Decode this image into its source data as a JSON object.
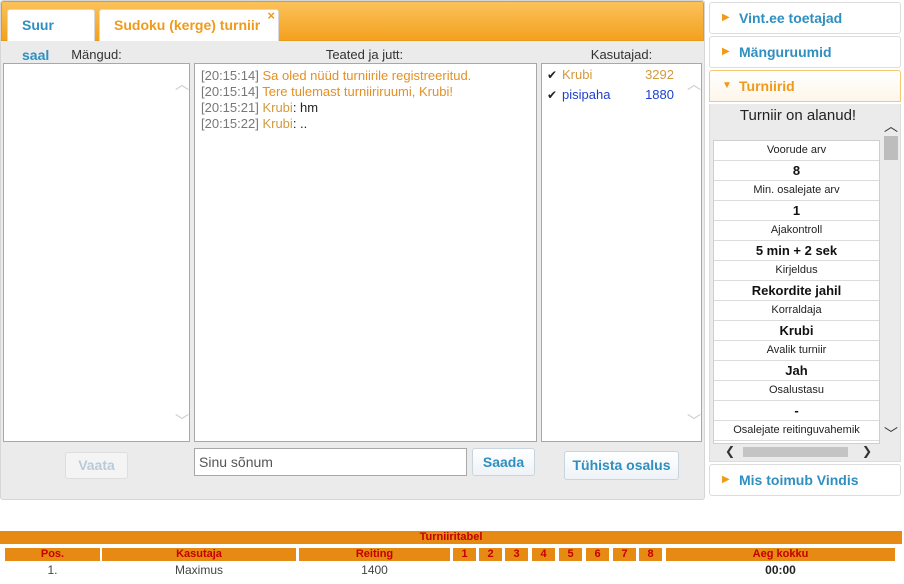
{
  "tabs": [
    {
      "label": "Suur saal"
    },
    {
      "label": "Sudoku (kerge) turniir",
      "close": "×"
    }
  ],
  "columns": {
    "games": "Mängud:",
    "chat": "Teated ja jutt:",
    "users": "Kasutajad:"
  },
  "chat": [
    {
      "time": "[20:15:14]",
      "text": "Sa oled nüüd turniirile registreeritud."
    },
    {
      "time": "[20:15:14]",
      "text": "Tere tulemast turniiriruumi, Krubi!"
    },
    {
      "time": "[20:15:21]",
      "nick": "Krubi",
      "text": ": hm"
    },
    {
      "time": "[20:15:22]",
      "nick": "Krubi",
      "text": ": .."
    }
  ],
  "users": [
    {
      "name": "Krubi",
      "rating": "3292",
      "color": "#d49a3d"
    },
    {
      "name": "pisipaha",
      "rating": "1880",
      "color": "#1c3fd0"
    }
  ],
  "buttons": {
    "view": "Vaata",
    "send": "Saada",
    "cancel": "Tühista osalus"
  },
  "message_input": {
    "placeholder": "Sinu sõnum",
    "value": ""
  },
  "sidebar": {
    "items": [
      {
        "label": "Vint.ee toetajad"
      },
      {
        "label": "Mänguruumid"
      },
      {
        "label": "Turniirid"
      },
      {
        "label": "Mis toimub Vindis"
      }
    ],
    "tournament_status": "Turniir on alanud!",
    "tournament_info": [
      {
        "label": "Voorude arv",
        "value": "8"
      },
      {
        "label": "Min. osalejate arv",
        "value": "1"
      },
      {
        "label": "Ajakontroll",
        "value": "5 min + 2 sek"
      },
      {
        "label": "Kirjeldus",
        "value": "Rekordite jahil"
      },
      {
        "label": "Korraldaja",
        "value": "Krubi"
      },
      {
        "label": "Avalik turniir",
        "value": "Jah"
      },
      {
        "label": "Osalustasu",
        "value": "-"
      },
      {
        "label": "Osalejate reitinguvahemik",
        "value": ""
      }
    ]
  },
  "standings": {
    "title": "Turniiritabel",
    "headers": [
      "Pos.",
      "Kasutaja",
      "Reiting",
      "1",
      "2",
      "3",
      "4",
      "5",
      "6",
      "7",
      "8",
      "Aeg kokku"
    ],
    "rows": [
      {
        "pos": "1.",
        "user": "Maximus",
        "rating": "1400",
        "total": "00:00"
      }
    ]
  },
  "colors": {
    "accent_orange": "#f3a11f",
    "link_blue": "#2f8fc0"
  }
}
